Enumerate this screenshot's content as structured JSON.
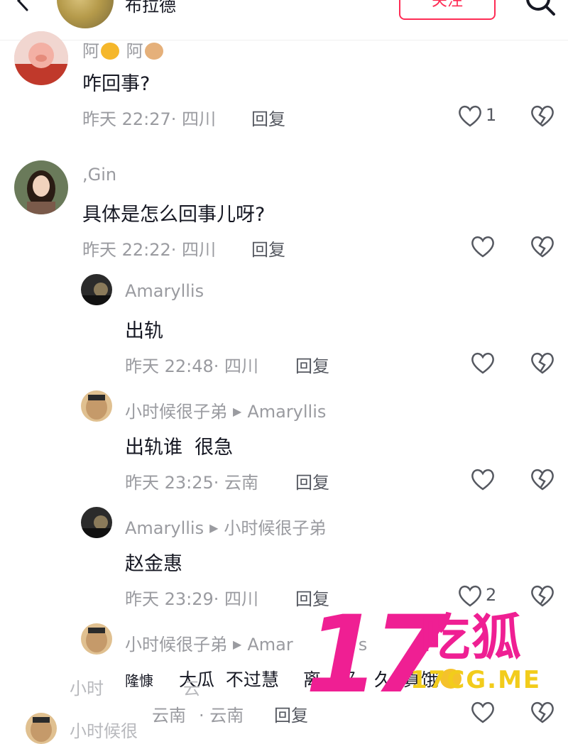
{
  "header": {
    "name": "布拉德",
    "follow_label": "关注"
  },
  "comments": [
    {
      "user": "阿",
      "user2": "阿",
      "text": "咋回事?",
      "time": "昨天 22:27· 四川",
      "reply": "回复",
      "likes": "1"
    },
    {
      "user": ",Gin",
      "text": "具体是怎么回事儿呀?",
      "time": "昨天 22:22· 四川",
      "reply": "回复"
    },
    {
      "user": "Amaryllis",
      "text": "出轨",
      "time": "昨天 22:48· 四川",
      "reply": "回复"
    },
    {
      "user": "小时候很子弟",
      "reply_to": "Amaryllis",
      "text": "出轨谁  很急",
      "time": "昨天 23:25· 云南",
      "reply": "回复"
    },
    {
      "user": "Amaryllis",
      "reply_to": "小时候很子弟",
      "text": "赵金惠",
      "time": "昨天 23:29· 四川",
      "reply": "回复",
      "likes": "2"
    },
    {
      "user": "小时候很子弟",
      "reply_to": "Amar",
      "reply_to_tail": "s",
      "text_a": "隆慷",
      "text_b": "大瓜  不过慧",
      "text_c": "离",
      "text_d": "那",
      "text_e": "久  真饿",
      "time_a": "云南",
      "time_b": "· 云南",
      "reply": "回复"
    }
  ],
  "ghost": {
    "line1": "小时",
    "line1b": "云",
    "line2": "小时候很"
  },
  "watermark": {
    "number": "17",
    "cn": "吃狐",
    "url": "17CG.ME"
  }
}
